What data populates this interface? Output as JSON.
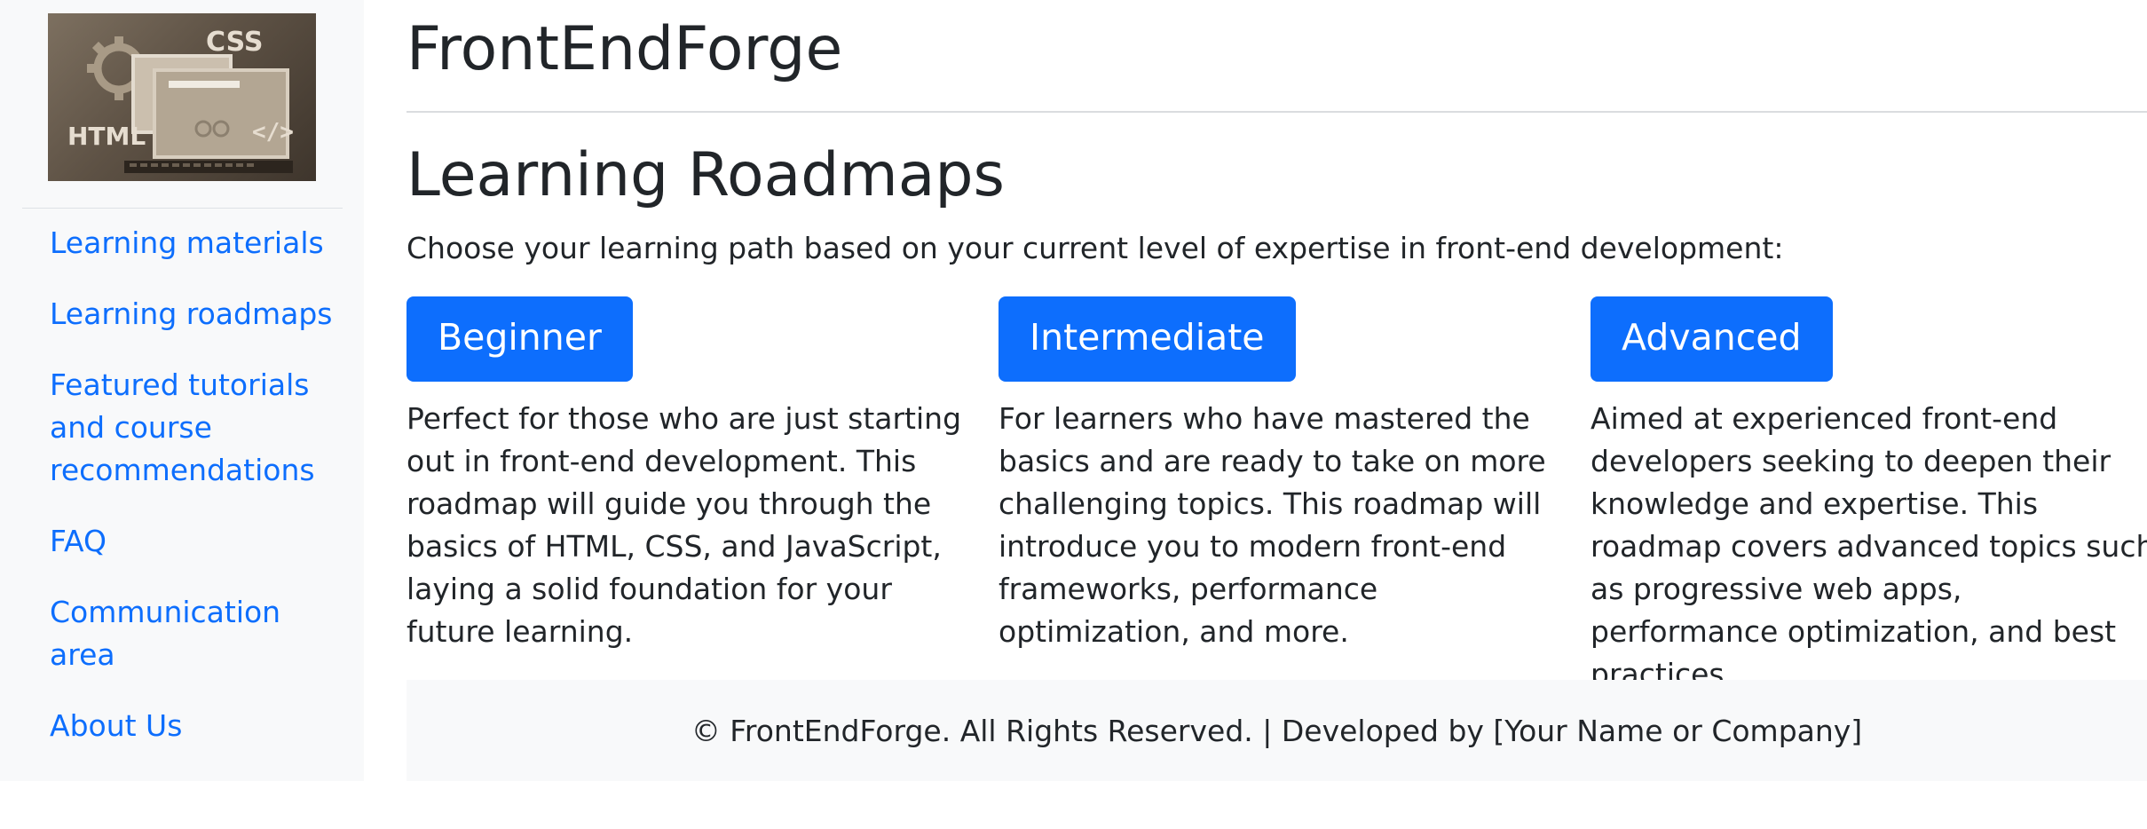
{
  "sidebar": {
    "logo": {
      "icon": "html-css-computer-logo",
      "text_css": "CSS",
      "text_html": "HTML",
      "text_code": "</>"
    },
    "items": [
      {
        "label": "Learning materials"
      },
      {
        "label": "Learning roadmaps"
      },
      {
        "label": "Featured tutorials and course recommendations"
      },
      {
        "label": "FAQ"
      },
      {
        "label": "Communication area"
      },
      {
        "label": "About Us"
      }
    ]
  },
  "header": {
    "brand": "FrontEndForge"
  },
  "main": {
    "title": "Learning Roadmaps",
    "lead": "Choose your learning path based on your current level of expertise in front-end development:",
    "levels": [
      {
        "button": "Beginner",
        "description": "Perfect for those who are just starting out in front-end development. This roadmap will guide you through the basics of HTML, CSS, and JavaScript, laying a solid foundation for your future learning."
      },
      {
        "button": "Intermediate",
        "description": "For learners who have mastered the basics and are ready to take on more challenging topics. This roadmap will introduce you to modern front-end frameworks, performance optimization, and more."
      },
      {
        "button": "Advanced",
        "description": "Aimed at experienced front-end developers seeking to deepen their knowledge and expertise. This roadmap covers advanced topics such as progressive web apps, performance optimization, and best practices."
      }
    ]
  },
  "footer": {
    "text": "© FrontEndForge. All Rights Reserved. | Developed by [Your Name or Company]"
  },
  "colors": {
    "accent": "#0d6efd",
    "sidebar_bg": "#f8f9fa",
    "text": "#212529"
  }
}
